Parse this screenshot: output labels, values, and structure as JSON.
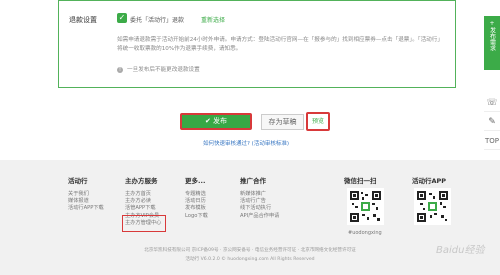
{
  "refund": {
    "label": "退款设置",
    "option": "委托「活动行」退款",
    "reselect": "重新选择",
    "description": "如需申请退款需于活动开始前24小时外申请。申请方式：登陆活动行官网—在「报参与的」找到相应票券—点击「退票」。「活动行」将统一收取票款的10%作为退票手续费，请知悉。",
    "note": "一旦发布后不能更改退款设置"
  },
  "actions": {
    "publish": "发布",
    "draft": "存为草稿",
    "preview": "预览",
    "quick_review": "如何快速审核通过?",
    "review_standard": "(活动审核标准)"
  },
  "footer": {
    "col1": {
      "title": "活动行",
      "items": [
        "关于我们",
        "媒体报道",
        "活动行APP下载"
      ]
    },
    "col2": {
      "title": "主办方服务",
      "items": [
        "主办方首页",
        "主办方必读",
        "活管APP下载",
        "主办方VIP会员",
        "主办方管理中心"
      ]
    },
    "col3": {
      "title": "更多...",
      "items": [
        "专题精选",
        "活动日历",
        "发布模板",
        "Logo下载"
      ]
    },
    "col4": {
      "title": "推广合作",
      "items": [
        "新媒体推广",
        "活动行广告",
        "线下活动执行",
        "API产品合作申请"
      ]
    },
    "qr1_title": "微信扫一扫",
    "qr2_title": "活动行APP",
    "qr1_caption": "#uodongxing",
    "copyright_1": "北京华凯科技有限公司 京ICP备09号 · 京公网安备号 · 电信业务经营许可证 · 北京市网络文化经营许可证",
    "copyright_2": "活动行 V6.0.2.0 © huodongxing.com All Rights Reserved"
  },
  "sidebar": {
    "feedback": "发布需求",
    "headset_icon": "headset-icon",
    "edit_icon": "edit-icon",
    "top": "TOP"
  },
  "watermark": "Baidu经验",
  "colors": {
    "accent": "#3cab48",
    "highlight": "#d8393a",
    "link": "#3a78c3"
  }
}
